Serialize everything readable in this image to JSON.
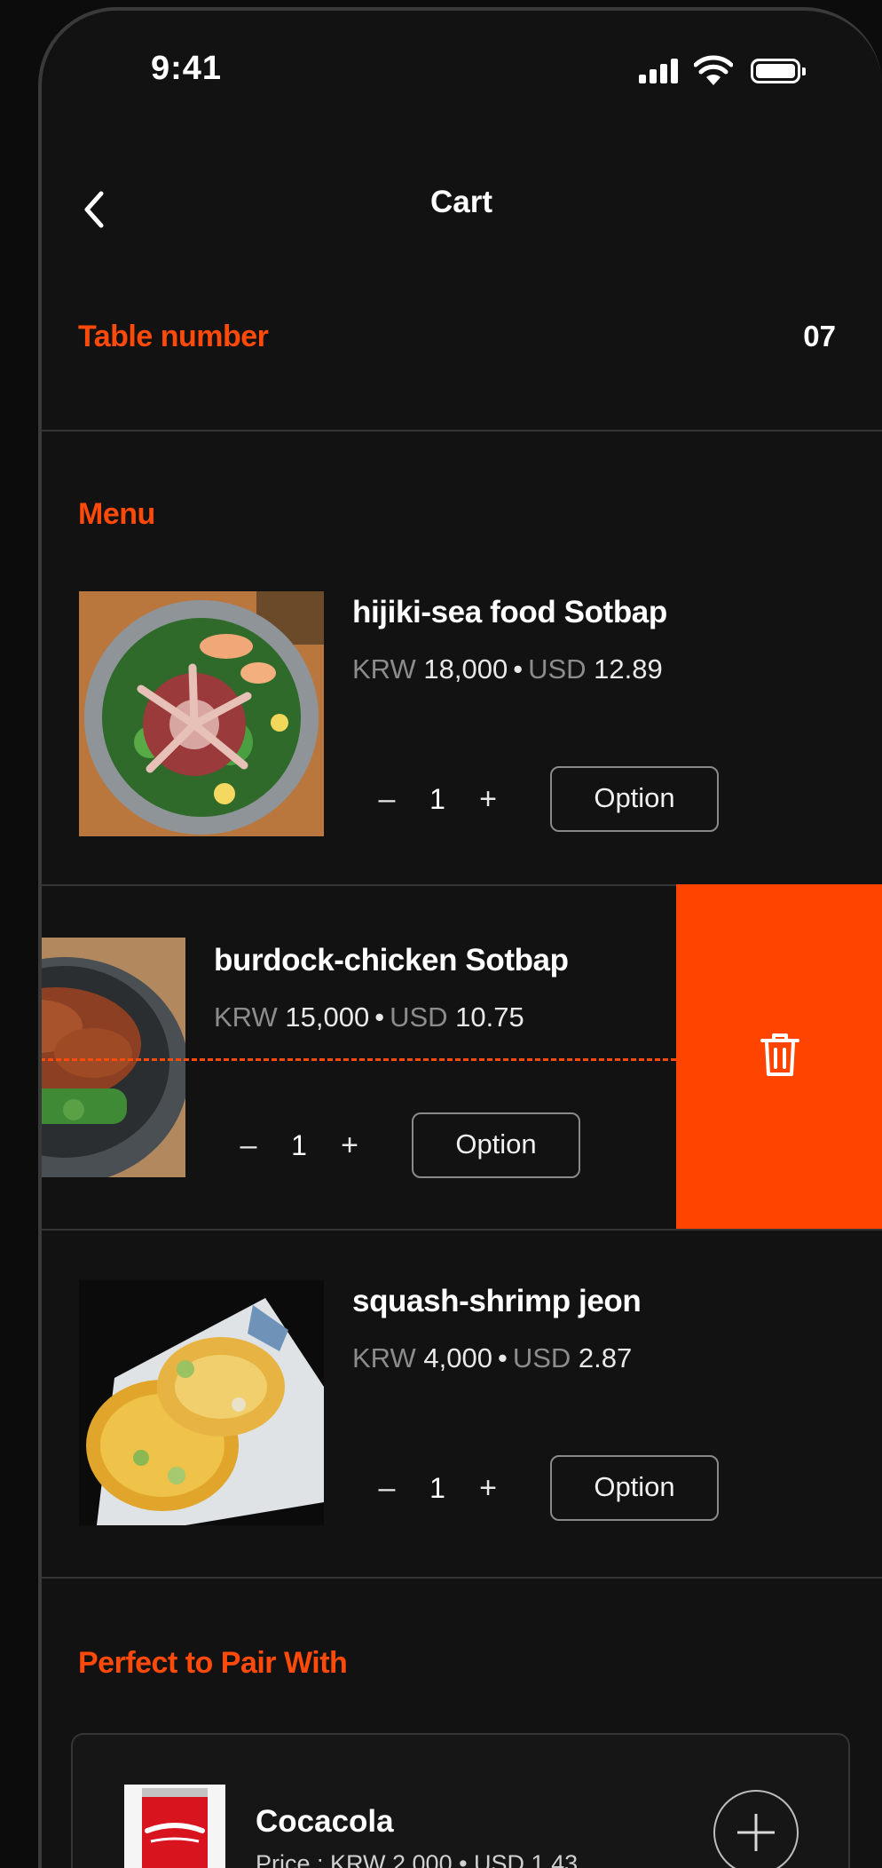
{
  "status_bar": {
    "time": "9:41"
  },
  "header": {
    "title": "Cart"
  },
  "table": {
    "label": "Table number",
    "value": "07"
  },
  "menu": {
    "label": "Menu",
    "items": [
      {
        "name": "hijiki-sea food Sotbap",
        "krw_label": "KRW",
        "krw": "18,000",
        "usd_label": "USD",
        "usd": "12.89",
        "quantity": "1",
        "option_label": "Option",
        "minus": "–",
        "plus": "+"
      },
      {
        "name": "burdock-chicken Sotbap",
        "krw_label": "KRW",
        "krw": "15,000",
        "usd_label": "USD",
        "usd": "10.75",
        "quantity": "1",
        "option_label": "Option",
        "minus": "–",
        "plus": "+"
      },
      {
        "name": "squash-shrimp jeon",
        "krw_label": "KRW",
        "krw": "4,000",
        "usd_label": "USD",
        "usd": "2.87",
        "quantity": "1",
        "option_label": "Option",
        "minus": "–",
        "plus": "+"
      }
    ],
    "separator": "•"
  },
  "pairing": {
    "label": "Perfect to Pair With",
    "items": [
      {
        "name": "Cocacola",
        "price": "Price : KRW 2,000 • USD 1.43"
      }
    ]
  },
  "colors": {
    "accent": "#ff4400",
    "background": "#121212",
    "divider": "#343434"
  },
  "icons": {
    "back": "chevron-left-icon",
    "delete": "trash-icon",
    "add": "plus-circle-icon"
  }
}
